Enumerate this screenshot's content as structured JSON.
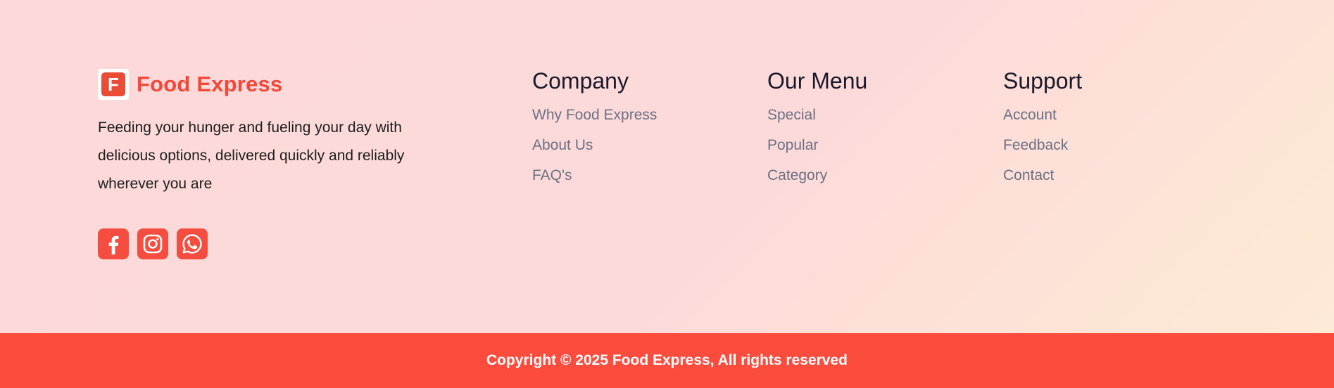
{
  "brand": {
    "logo_letter": "F",
    "name": "Food Express",
    "tagline": "Feeding your hunger and fueling your day with delicious options, delivered quickly and reliably wherever you are",
    "color": "#f2483a"
  },
  "socials": [
    {
      "icon": "facebook-icon"
    },
    {
      "icon": "instagram-icon"
    },
    {
      "icon": "whatsapp-icon"
    }
  ],
  "columns": {
    "company": {
      "title": "Company",
      "links": [
        "Why Food Express",
        "About Us",
        "FAQ's"
      ]
    },
    "menu": {
      "title": "Our Menu",
      "links": [
        "Special",
        "Popular",
        "Category"
      ]
    },
    "support": {
      "title": "Support",
      "links": [
        "Account",
        "Feedback",
        "Contact"
      ]
    }
  },
  "footer": {
    "copyright": "Copyright © 2025 Food Express, All rights reserved",
    "bar_color": "#fc4c3e"
  }
}
